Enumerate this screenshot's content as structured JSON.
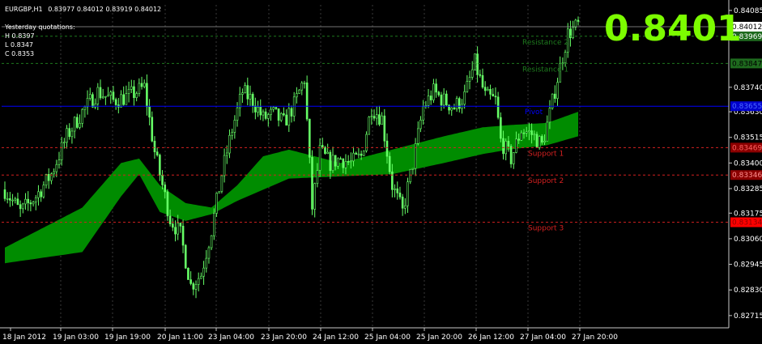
{
  "header": {
    "symbol": "EURGBP,H1",
    "ohlc": "0.83977 0.84012 0.83919 0.84012"
  },
  "yesterday": {
    "title": "Yesterday quotations:",
    "high": "H 0.8397",
    "low": "L 0.8347",
    "close": "C 0.8353"
  },
  "big_price": "0.8401",
  "colors": {
    "background": "#000000",
    "candle": "#66ff66",
    "ribbon": "#008c00",
    "grid": "#3a3a3a",
    "resistance": "#1e7a1e",
    "support": "#d42020",
    "pivot": "#0000ff",
    "big_price": "#7cfc00"
  },
  "chart_data": {
    "type": "candlestick",
    "ylim": [
      0.8266,
      0.8411
    ],
    "price_axis_ticks": [
      "0.84085",
      "0.83740",
      "0.83630",
      "0.83515",
      "0.83400",
      "0.83285",
      "0.83175",
      "0.83060",
      "0.82945",
      "0.82830",
      "0.82715"
    ],
    "time_axis_labels": [
      "18 Jan 2012",
      "19 Jan 03:00",
      "19 Jan 19:00",
      "20 Jan 11:00",
      "23 Jan 04:00",
      "23 Jan 20:00",
      "24 Jan 12:00",
      "25 Jan 04:00",
      "25 Jan 20:00",
      "26 Jan 12:00",
      "27 Jan 04:00",
      "27 Jan 20:00"
    ],
    "levels": [
      {
        "name": "Resistance 2",
        "price": 0.83969,
        "tag": "0.83969",
        "color": "#1e7a1e"
      },
      {
        "name": "Resistance 1",
        "price": 0.83847,
        "tag": "0.83847",
        "color": "#1e7a1e"
      },
      {
        "name": "Pivot",
        "price": 0.83655,
        "tag": "0.83655",
        "color": "#0000ff"
      },
      {
        "name": "Support 1",
        "price": 0.83469,
        "tag": "0.83469",
        "color": "#d42020"
      },
      {
        "name": "Support 2",
        "price": 0.83346,
        "tag": "0.83346",
        "color": "#d42020"
      },
      {
        "name": "Support 3",
        "price": 0.83134,
        "tag": "0.83134",
        "color": "#d42020"
      }
    ],
    "current": {
      "price": 0.84012,
      "tag": "0.84012"
    },
    "candle_anchors": [
      [
        0,
        0.8328
      ],
      [
        6,
        0.8318
      ],
      [
        12,
        0.8325
      ],
      [
        18,
        0.8335
      ],
      [
        24,
        0.8352
      ],
      [
        30,
        0.8363
      ],
      [
        36,
        0.8372
      ],
      [
        42,
        0.8368
      ],
      [
        48,
        0.837
      ],
      [
        54,
        0.8374
      ],
      [
        58,
        0.8345
      ],
      [
        64,
        0.8315
      ],
      [
        68,
        0.8308
      ],
      [
        72,
        0.8285
      ],
      [
        76,
        0.829
      ],
      [
        80,
        0.831
      ],
      [
        84,
        0.8335
      ],
      [
        88,
        0.8355
      ],
      [
        92,
        0.8372
      ],
      [
        96,
        0.8368
      ],
      [
        100,
        0.836
      ],
      [
        104,
        0.8362
      ],
      [
        108,
        0.8358
      ],
      [
        112,
        0.8366
      ],
      [
        116,
        0.8378
      ],
      [
        119,
        0.832
      ],
      [
        122,
        0.8345
      ],
      [
        126,
        0.834
      ],
      [
        130,
        0.8342
      ],
      [
        134,
        0.834
      ],
      [
        138,
        0.8343
      ],
      [
        142,
        0.8365
      ],
      [
        146,
        0.836
      ],
      [
        150,
        0.833
      ],
      [
        154,
        0.8318
      ],
      [
        158,
        0.834
      ],
      [
        162,
        0.8365
      ],
      [
        166,
        0.8372
      ],
      [
        170,
        0.8368
      ],
      [
        174,
        0.8365
      ],
      [
        178,
        0.837
      ],
      [
        182,
        0.8385
      ],
      [
        186,
        0.837
      ],
      [
        190,
        0.8368
      ],
      [
        192,
        0.835
      ],
      [
        196,
        0.8342
      ],
      [
        200,
        0.8355
      ],
      [
        204,
        0.8353
      ],
      [
        208,
        0.8348
      ],
      [
        211,
        0.8362
      ],
      [
        214,
        0.8378
      ],
      [
        218,
        0.8398
      ],
      [
        222,
        0.8402
      ]
    ],
    "ribbon_anchors": [
      [
        0,
        0.8302,
        0.8295
      ],
      [
        30,
        0.832,
        0.83
      ],
      [
        45,
        0.834,
        0.8325
      ],
      [
        52,
        0.8342,
        0.8335
      ],
      [
        60,
        0.833,
        0.8318
      ],
      [
        70,
        0.8322,
        0.8314
      ],
      [
        80,
        0.832,
        0.8317
      ],
      [
        90,
        0.833,
        0.8323
      ],
      [
        100,
        0.8343,
        0.8328
      ],
      [
        110,
        0.8346,
        0.8333
      ],
      [
        130,
        0.834,
        0.8334
      ],
      [
        150,
        0.8346,
        0.8335
      ],
      [
        170,
        0.8352,
        0.834
      ],
      [
        185,
        0.8356,
        0.8344
      ],
      [
        195,
        0.8357,
        0.8346
      ],
      [
        210,
        0.8358,
        0.8348
      ],
      [
        222,
        0.8363,
        0.8352
      ]
    ]
  }
}
